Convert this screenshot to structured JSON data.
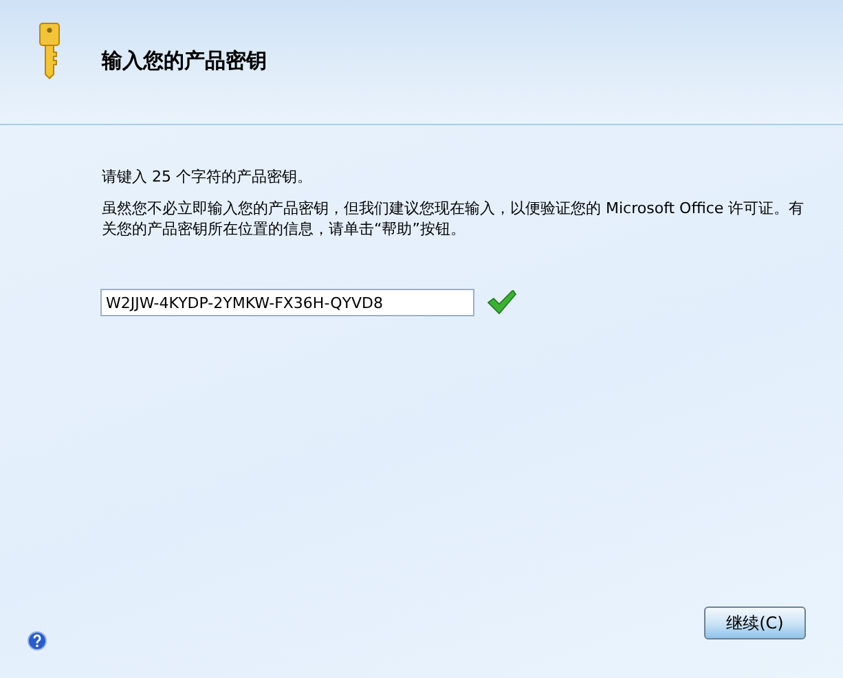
{
  "header": {
    "title": "输入您的产品密钥"
  },
  "instruction": "请键入 25 个字符的产品密钥。",
  "description": "虽然您不必立即输入您的产品密钥，但我们建议您现在输入，以便验证您的 Microsoft Office 许可证。有关您的产品密钥所在位置的信息，请单击“帮助”按钮。",
  "product_key": {
    "value": "W2JJW-4KYDP-2YMKW-FX36H-QYVD8",
    "valid": true
  },
  "buttons": [
    {
      "label": "继续(C)"
    }
  ]
}
